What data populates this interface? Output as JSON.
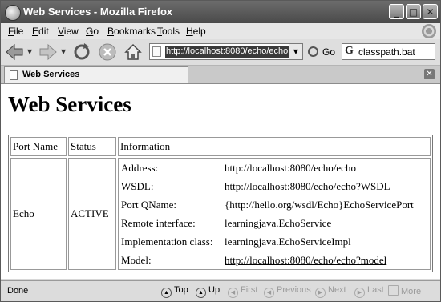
{
  "window": {
    "title": "Web Services - Mozilla Firefox"
  },
  "menu": {
    "items": [
      "File",
      "Edit",
      "View",
      "Go",
      "Bookmarks",
      "Tools",
      "Help"
    ]
  },
  "nav": {
    "url": "http://localhost:8080/echo/echo",
    "go_label": "Go",
    "search_text": "classpath.bat"
  },
  "tab": {
    "label": "Web Services"
  },
  "page": {
    "title": "Web Services",
    "table": {
      "headers": [
        "Port Name",
        "Status",
        "Information"
      ],
      "row": {
        "port_name": "Echo",
        "status": "ACTIVE",
        "info": [
          {
            "label": "Address:",
            "value": "http://localhost:8080/echo/echo"
          },
          {
            "label": "WSDL:",
            "value": "http://localhost:8080/echo/echo?WSDL"
          },
          {
            "label": "Port QName:",
            "value": "{http://hello.org/wsdl/Echo}EchoServicePort"
          },
          {
            "label": "Remote interface:",
            "value": "learningjava.EchoService"
          },
          {
            "label": "Implementation class:",
            "value": "learningjava.EchoServiceImpl"
          },
          {
            "label": "Model:",
            "value": "http://localhost:8080/echo/echo?model"
          }
        ]
      }
    }
  },
  "status": {
    "text": "Done",
    "buttons": [
      "Top",
      "Up",
      "First",
      "Previous",
      "Next",
      "Last",
      "More"
    ]
  }
}
